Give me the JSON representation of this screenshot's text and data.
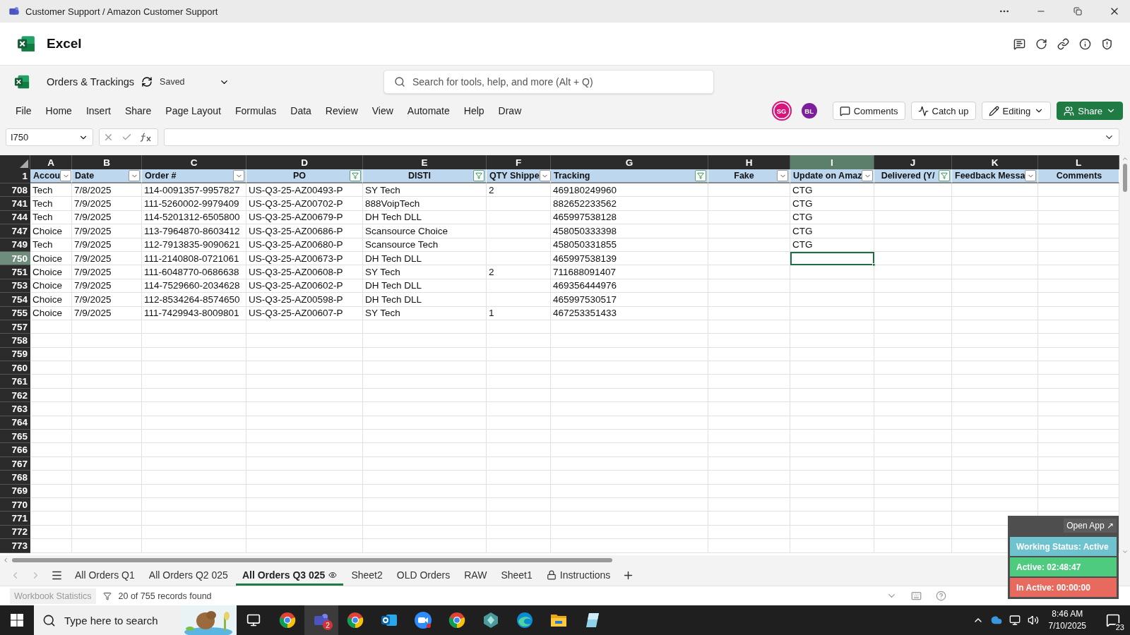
{
  "window": {
    "title": "Customer Support / Amazon Customer Support"
  },
  "app": {
    "name": "Excel"
  },
  "document": {
    "name": "Orders & Trackings",
    "status": "Saved"
  },
  "search": {
    "placeholder": "Search for tools, help, and more (Alt + Q)"
  },
  "menu": [
    "File",
    "Home",
    "Insert",
    "Share",
    "Page Layout",
    "Formulas",
    "Data",
    "Review",
    "View",
    "Automate",
    "Help",
    "Draw"
  ],
  "collaborators": [
    {
      "initials": "SG",
      "color": "#d9157b",
      "active": true
    },
    {
      "initials": "BL",
      "color": "#7d1f9c",
      "active": false
    }
  ],
  "ribbon_buttons": [
    {
      "kind": "comments",
      "label": "Comments"
    },
    {
      "kind": "catchup",
      "label": "Catch up"
    },
    {
      "kind": "editing",
      "label": "Editing"
    },
    {
      "kind": "share",
      "label": "Share"
    }
  ],
  "name_box": {
    "value": "I750"
  },
  "columns": [
    {
      "letter": "A",
      "header": "Accou",
      "centered": false,
      "filter_button": true,
      "filtered": false,
      "selected": false
    },
    {
      "letter": "B",
      "header": "Date",
      "centered": false,
      "filter_button": true,
      "filtered": false,
      "selected": false
    },
    {
      "letter": "C",
      "header": "Order #",
      "centered": false,
      "filter_button": true,
      "filtered": false,
      "selected": false
    },
    {
      "letter": "D",
      "header": "PO",
      "centered": true,
      "filter_button": true,
      "filtered": true,
      "selected": false
    },
    {
      "letter": "E",
      "header": "DISTI",
      "centered": true,
      "filter_button": true,
      "filtered": true,
      "selected": false
    },
    {
      "letter": "F",
      "header": "QTY Shippe",
      "centered": false,
      "filter_button": true,
      "filtered": false,
      "selected": false
    },
    {
      "letter": "G",
      "header": "Tracking",
      "centered": false,
      "filter_button": true,
      "filtered": true,
      "selected": false
    },
    {
      "letter": "H",
      "header": "Fake",
      "centered": true,
      "filter_button": true,
      "filtered": false,
      "selected": false
    },
    {
      "letter": "I",
      "header": "Update on Amaz",
      "centered": false,
      "filter_button": true,
      "filtered": false,
      "selected": true
    },
    {
      "letter": "J",
      "header": "Delivered (Y/",
      "centered": true,
      "filter_button": true,
      "filtered": true,
      "selected": false
    },
    {
      "letter": "K",
      "header": "Feedback Messa",
      "centered": false,
      "filter_button": true,
      "filtered": false,
      "selected": false
    },
    {
      "letter": "L",
      "header": "Comments",
      "centered": true,
      "filter_button": false,
      "selected": false
    }
  ],
  "header_row": "1",
  "rows": [
    {
      "num": "708",
      "selected": false,
      "cells": [
        "Tech",
        "7/8/2025",
        "114-0091357-9957827",
        "US-Q3-25-AZ00493-P",
        "SY Tech",
        "2",
        "469180249960",
        null,
        "CTG"
      ]
    },
    {
      "num": "741",
      "selected": false,
      "cells": [
        "Tech",
        "7/9/2025",
        "111-5260002-9979409",
        "US-Q3-25-AZ00702-P",
        "888VoipTech",
        null,
        "882652233562",
        null,
        "CTG"
      ]
    },
    {
      "num": "744",
      "selected": false,
      "cells": [
        "Tech",
        "7/9/2025",
        "114-5201312-6505800",
        "US-Q3-25-AZ00679-P",
        "DH Tech DLL",
        null,
        "465997538128",
        null,
        "CTG"
      ]
    },
    {
      "num": "747",
      "selected": false,
      "cells": [
        "Choice",
        "7/9/2025",
        "113-7964870-8603412",
        "US-Q3-25-AZ00686-P",
        "Scansource Choice",
        null,
        "458050333398",
        null,
        "CTG"
      ]
    },
    {
      "num": "749",
      "selected": false,
      "cells": [
        "Tech",
        "7/9/2025",
        "112-7913835-9090621",
        "US-Q3-25-AZ00680-P",
        "Scansource Tech",
        null,
        "458050331855",
        null,
        "CTG"
      ]
    },
    {
      "num": "750",
      "selected": true,
      "cells": [
        "Choice",
        "7/9/2025",
        "111-2140808-0721061",
        "US-Q3-25-AZ00673-P",
        "DH Tech DLL",
        null,
        "465997538139"
      ]
    },
    {
      "num": "751",
      "selected": false,
      "cells": [
        "Choice",
        "7/9/2025",
        "111-6048770-0686638",
        "US-Q3-25-AZ00608-P",
        "SY Tech",
        "2",
        "711688091407"
      ]
    },
    {
      "num": "753",
      "selected": false,
      "cells": [
        "Choice",
        "7/9/2025",
        "114-7529660-2034628",
        "US-Q3-25-AZ00602-P",
        "DH Tech DLL",
        null,
        "469356444976"
      ]
    },
    {
      "num": "754",
      "selected": false,
      "cells": [
        "Choice",
        "7/9/2025",
        "112-8534264-8574650",
        "US-Q3-25-AZ00598-P",
        "DH Tech DLL",
        null,
        "465997530517"
      ]
    },
    {
      "num": "755",
      "selected": false,
      "cells": [
        "Choice",
        "7/9/2025",
        "111-7429943-8009801",
        "US-Q3-25-AZ00607-P",
        "SY Tech",
        "1",
        "467253351433"
      ]
    },
    {
      "num": "757",
      "selected": false
    },
    {
      "num": "758",
      "selected": false
    },
    {
      "num": "759",
      "selected": false
    },
    {
      "num": "760",
      "selected": false
    },
    {
      "num": "761",
      "selected": false
    },
    {
      "num": "762",
      "selected": false
    },
    {
      "num": "763",
      "selected": false
    },
    {
      "num": "764",
      "selected": false
    },
    {
      "num": "765",
      "selected": false
    },
    {
      "num": "766",
      "selected": false
    },
    {
      "num": "767",
      "selected": false
    },
    {
      "num": "768",
      "selected": false
    },
    {
      "num": "769",
      "selected": false
    },
    {
      "num": "770",
      "selected": false
    },
    {
      "num": "771",
      "selected": false
    },
    {
      "num": "772",
      "selected": false
    },
    {
      "num": "773",
      "selected": false
    }
  ],
  "sheet_tabs": [
    {
      "label": "All Orders Q1",
      "kind": "plain",
      "selected": false
    },
    {
      "label": "All Orders Q2 025",
      "kind": "plain",
      "selected": false
    },
    {
      "label": "All Orders Q3 025",
      "kind": "watched",
      "selected": true
    },
    {
      "label": "Sheet2",
      "kind": "plain",
      "selected": false
    },
    {
      "label": "OLD Orders",
      "kind": "plain",
      "selected": false
    },
    {
      "label": "RAW",
      "kind": "plain",
      "selected": false
    },
    {
      "label": "Sheet1",
      "kind": "plain",
      "selected": false
    },
    {
      "label": "Instructions",
      "kind": "locked",
      "selected": false
    }
  ],
  "status_bar": {
    "statistics": "Workbook Statistics",
    "records": "20 of 755 records found"
  },
  "widget": {
    "button": "Open App ↗",
    "items": [
      {
        "label": "Working Status: Active",
        "color": "#6ec3cf"
      },
      {
        "label": "Active: 02:48:47",
        "color": "#4fcb80"
      },
      {
        "label": "In Active: 00:00:00",
        "color": "#e86a5e"
      }
    ]
  },
  "taskbar": {
    "search_placeholder": "Type here to search",
    "apps": [
      {
        "kind": "taskview",
        "active": false
      },
      {
        "kind": "browser",
        "active": false
      },
      {
        "kind": "chat",
        "active": true,
        "badge": "2"
      },
      {
        "kind": "browser",
        "active": false
      },
      {
        "kind": "mail",
        "active": false
      },
      {
        "kind": "video",
        "active": false
      },
      {
        "kind": "browser",
        "active": false
      },
      {
        "kind": "hexagon",
        "active": false
      },
      {
        "kind": "edge",
        "active": false
      },
      {
        "kind": "folder",
        "active": false
      },
      {
        "kind": "notes",
        "active": false
      }
    ],
    "time": "8:46 AM",
    "date": "7/10/2025",
    "notifications": "23"
  }
}
